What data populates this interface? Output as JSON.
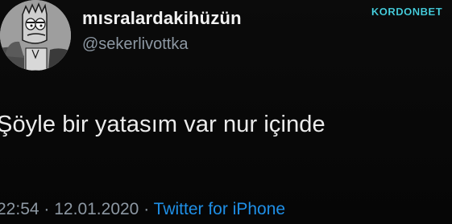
{
  "tweet": {
    "display_name": "mısralardakihüzün",
    "handle": "@sekerlivottka",
    "text": "Şöyle bir yatasım var nur içinde",
    "time": "22:54",
    "separator": "·",
    "date": "12.01.2020",
    "source": "Twitter for iPhone"
  },
  "avatar": {
    "icon": "cartoon-character-avatar"
  },
  "watermark": {
    "text": "KORDONBET"
  },
  "colors": {
    "background": "#080808",
    "name": "#f2f2f2",
    "secondary": "#8d98a3",
    "link": "#1f8fe6",
    "watermark": "#4dd9e8"
  }
}
